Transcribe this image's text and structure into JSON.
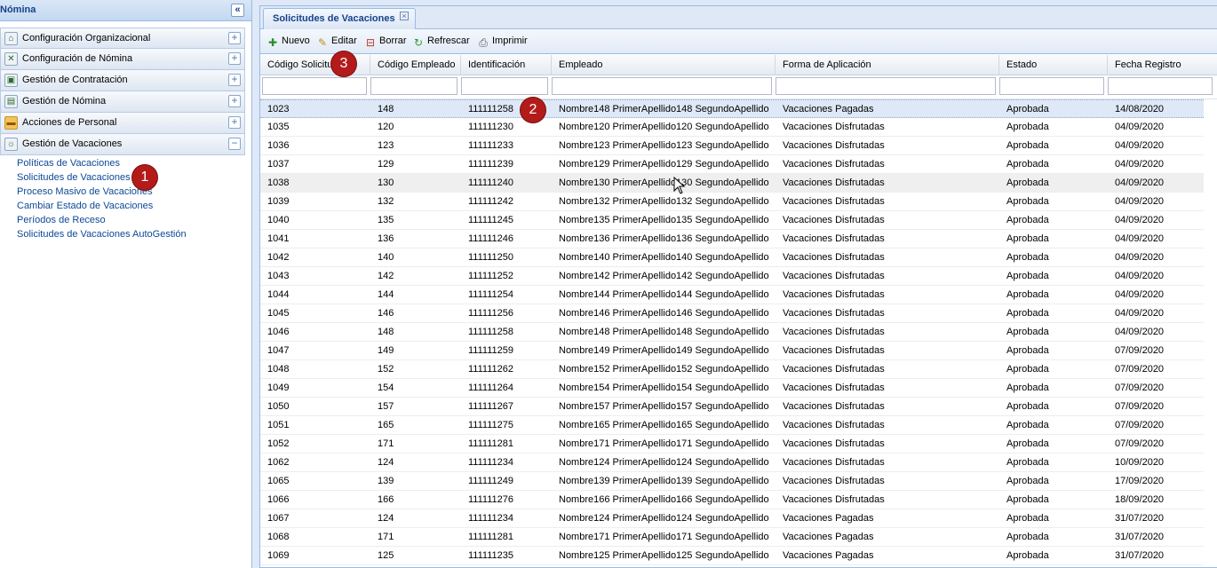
{
  "left_panel": {
    "title": "Nómina",
    "collapse_glyph": "«",
    "menu": [
      {
        "label": "Configuración Organizacional",
        "icon": "home-icon",
        "toggle": "+"
      },
      {
        "label": "Configuración de Nómina",
        "icon": "tools-icon",
        "toggle": "+"
      },
      {
        "label": "Gestión de Contratación",
        "icon": "contract-icon",
        "toggle": "+"
      },
      {
        "label": "Gestión de Nómina",
        "icon": "payroll-icon",
        "toggle": "+"
      },
      {
        "label": "Acciones de Personal",
        "icon": "folder-icon",
        "toggle": "+"
      },
      {
        "label": "Gestión de Vacaciones",
        "icon": "vacation-icon",
        "toggle": "−"
      }
    ],
    "submenu": [
      "Políticas de Vacaciones",
      "Solicitudes de Vacaciones",
      "Proceso Masivo de Vacaciones",
      "Cambiar Estado de Vacaciones",
      "Períodos de Receso",
      "Solicitudes de Vacaciones AutoGestión"
    ]
  },
  "badges": [
    "1",
    "2",
    "3"
  ],
  "tab": {
    "label": "Solicitudes de Vacaciones",
    "close_glyph": "×"
  },
  "toolbar": {
    "nuevo": "Nuevo",
    "editar": "Editar",
    "borrar": "Borrar",
    "refrescar": "Refrescar",
    "imprimir": "Imprimir"
  },
  "grid": {
    "columns": [
      "Código Solicitud",
      "Código Empleado",
      "Identificación",
      "Empleado",
      "Forma de Aplicación",
      "Estado",
      "Fecha Registro"
    ],
    "rows": [
      [
        "1023",
        "148",
        "111111258",
        "Nombre148 PrimerApellido148 SegundoApellido",
        "Vacaciones Pagadas",
        "Aprobada",
        "14/08/2020"
      ],
      [
        "1035",
        "120",
        "111111230",
        "Nombre120 PrimerApellido120 SegundoApellido",
        "Vacaciones Disfrutadas",
        "Aprobada",
        "04/09/2020"
      ],
      [
        "1036",
        "123",
        "111111233",
        "Nombre123 PrimerApellido123 SegundoApellido",
        "Vacaciones Disfrutadas",
        "Aprobada",
        "04/09/2020"
      ],
      [
        "1037",
        "129",
        "111111239",
        "Nombre129 PrimerApellido129 SegundoApellido",
        "Vacaciones Disfrutadas",
        "Aprobada",
        "04/09/2020"
      ],
      [
        "1038",
        "130",
        "111111240",
        "Nombre130 PrimerApellido130 SegundoApellido",
        "Vacaciones Disfrutadas",
        "Aprobada",
        "04/09/2020"
      ],
      [
        "1039",
        "132",
        "111111242",
        "Nombre132 PrimerApellido132 SegundoApellido",
        "Vacaciones Disfrutadas",
        "Aprobada",
        "04/09/2020"
      ],
      [
        "1040",
        "135",
        "111111245",
        "Nombre135 PrimerApellido135 SegundoApellido",
        "Vacaciones Disfrutadas",
        "Aprobada",
        "04/09/2020"
      ],
      [
        "1041",
        "136",
        "111111246",
        "Nombre136 PrimerApellido136 SegundoApellido",
        "Vacaciones Disfrutadas",
        "Aprobada",
        "04/09/2020"
      ],
      [
        "1042",
        "140",
        "111111250",
        "Nombre140 PrimerApellido140 SegundoApellido",
        "Vacaciones Disfrutadas",
        "Aprobada",
        "04/09/2020"
      ],
      [
        "1043",
        "142",
        "111111252",
        "Nombre142 PrimerApellido142 SegundoApellido",
        "Vacaciones Disfrutadas",
        "Aprobada",
        "04/09/2020"
      ],
      [
        "1044",
        "144",
        "111111254",
        "Nombre144 PrimerApellido144 SegundoApellido",
        "Vacaciones Disfrutadas",
        "Aprobada",
        "04/09/2020"
      ],
      [
        "1045",
        "146",
        "111111256",
        "Nombre146 PrimerApellido146 SegundoApellido",
        "Vacaciones Disfrutadas",
        "Aprobada",
        "04/09/2020"
      ],
      [
        "1046",
        "148",
        "111111258",
        "Nombre148 PrimerApellido148 SegundoApellido",
        "Vacaciones Disfrutadas",
        "Aprobada",
        "04/09/2020"
      ],
      [
        "1047",
        "149",
        "111111259",
        "Nombre149 PrimerApellido149 SegundoApellido",
        "Vacaciones Disfrutadas",
        "Aprobada",
        "07/09/2020"
      ],
      [
        "1048",
        "152",
        "111111262",
        "Nombre152 PrimerApellido152 SegundoApellido",
        "Vacaciones Disfrutadas",
        "Aprobada",
        "07/09/2020"
      ],
      [
        "1049",
        "154",
        "111111264",
        "Nombre154 PrimerApellido154 SegundoApellido",
        "Vacaciones Disfrutadas",
        "Aprobada",
        "07/09/2020"
      ],
      [
        "1050",
        "157",
        "111111267",
        "Nombre157 PrimerApellido157 SegundoApellido",
        "Vacaciones Disfrutadas",
        "Aprobada",
        "07/09/2020"
      ],
      [
        "1051",
        "165",
        "111111275",
        "Nombre165 PrimerApellido165 SegundoApellido",
        "Vacaciones Disfrutadas",
        "Aprobada",
        "07/09/2020"
      ],
      [
        "1052",
        "171",
        "111111281",
        "Nombre171 PrimerApellido171 SegundoApellido",
        "Vacaciones Disfrutadas",
        "Aprobada",
        "07/09/2020"
      ],
      [
        "1062",
        "124",
        "111111234",
        "Nombre124 PrimerApellido124 SegundoApellido",
        "Vacaciones Disfrutadas",
        "Aprobada",
        "10/09/2020"
      ],
      [
        "1065",
        "139",
        "111111249",
        "Nombre139 PrimerApellido139 SegundoApellido",
        "Vacaciones Disfrutadas",
        "Aprobada",
        "17/09/2020"
      ],
      [
        "1066",
        "166",
        "111111276",
        "Nombre166 PrimerApellido166 SegundoApellido",
        "Vacaciones Disfrutadas",
        "Aprobada",
        "18/09/2020"
      ],
      [
        "1067",
        "124",
        "111111234",
        "Nombre124 PrimerApellido124 SegundoApellido",
        "Vacaciones Pagadas",
        "Aprobada",
        "31/07/2020"
      ],
      [
        "1068",
        "171",
        "111111281",
        "Nombre171 PrimerApellido171 SegundoApellido",
        "Vacaciones Pagadas",
        "Aprobada",
        "31/07/2020"
      ],
      [
        "1069",
        "125",
        "111111235",
        "Nombre125 PrimerApellido125 SegundoApellido",
        "Vacaciones Pagadas",
        "Aprobada",
        "31/07/2020"
      ]
    ]
  },
  "colors": {
    "accent": "#15428b",
    "badge": "#b31b1b",
    "link": "#0d4896"
  }
}
